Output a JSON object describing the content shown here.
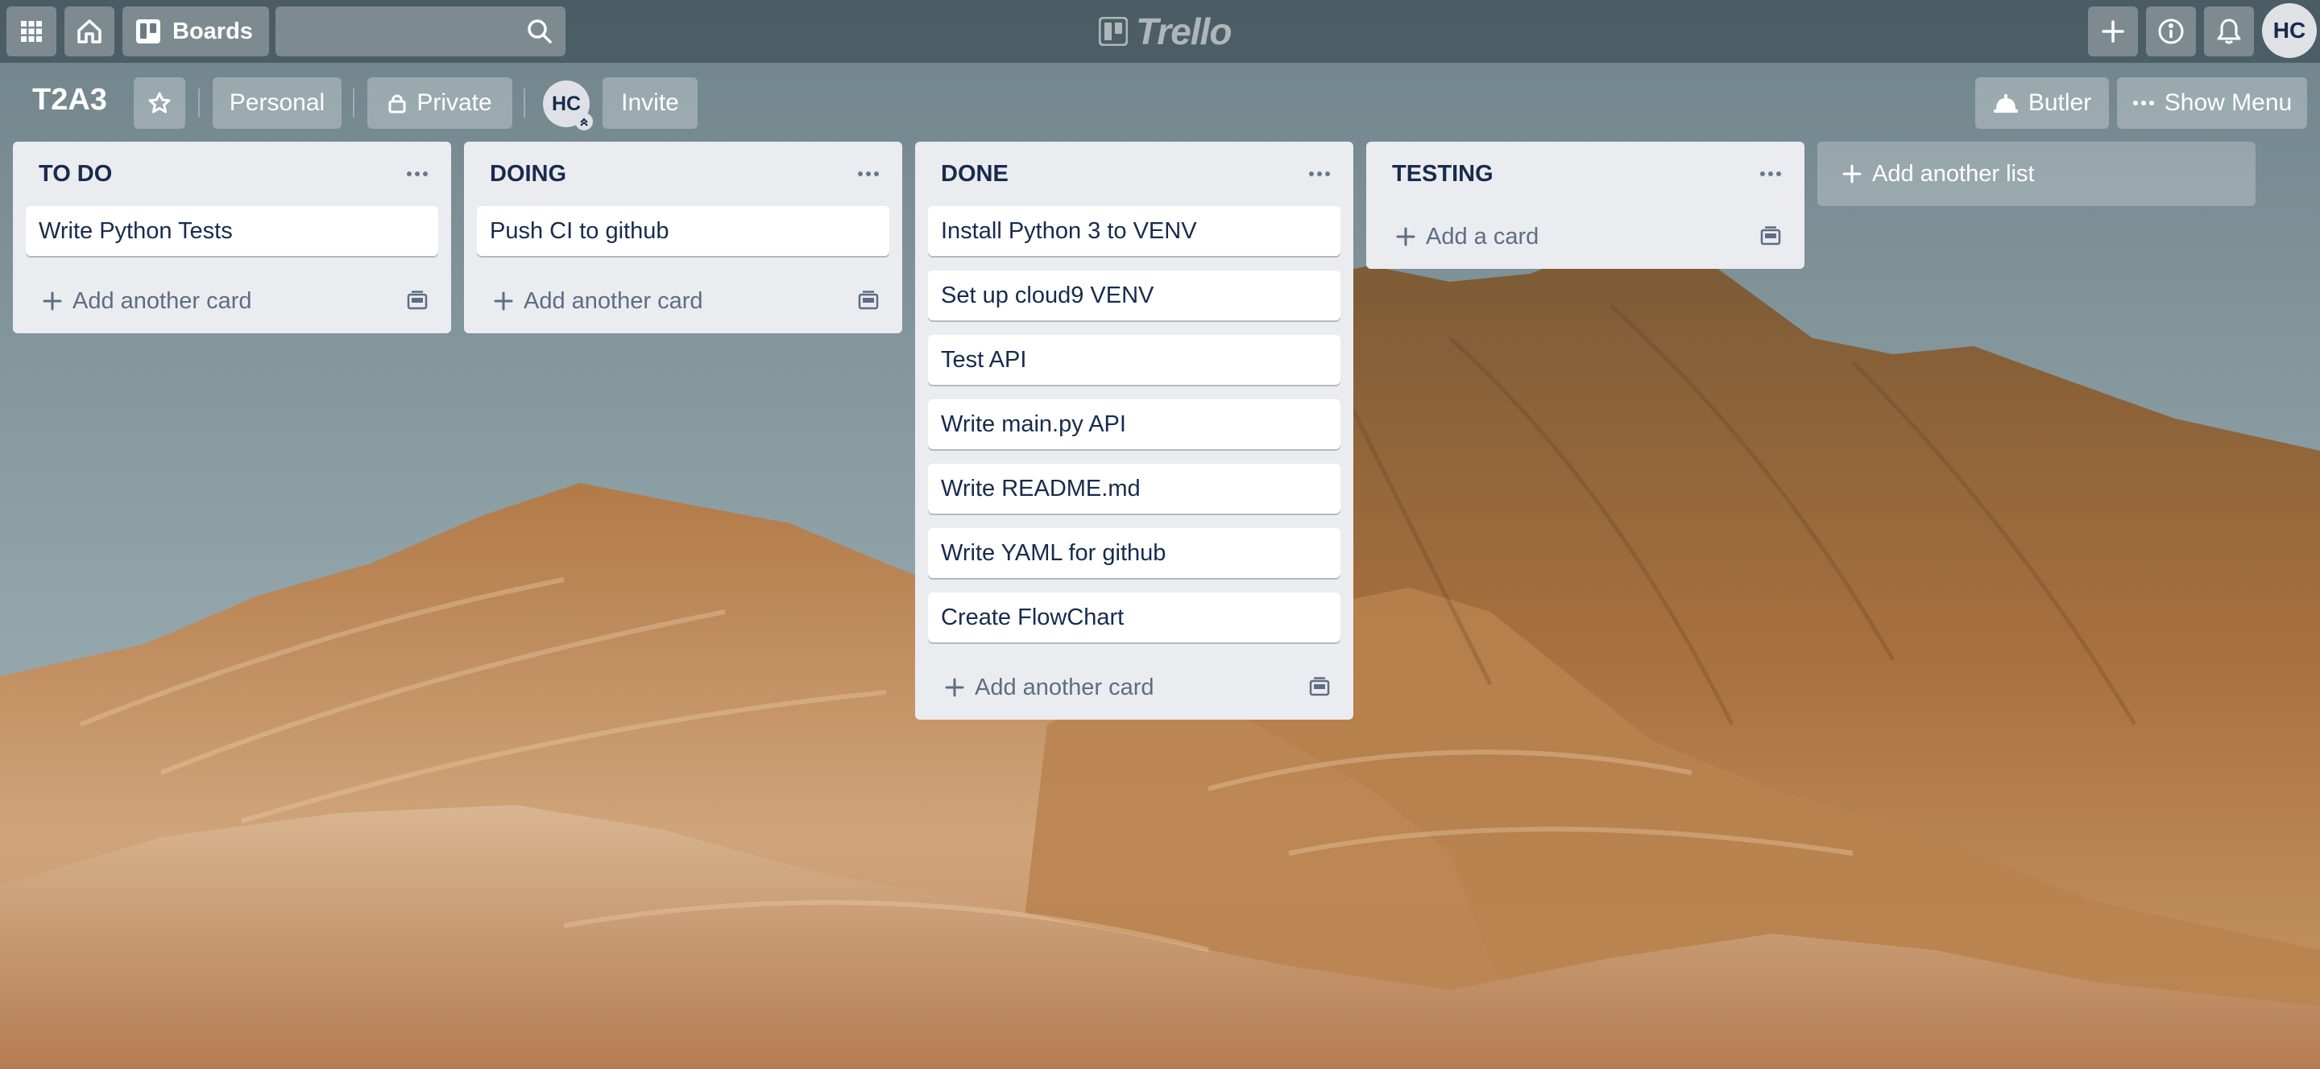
{
  "header": {
    "apps_icon": "grid-icon",
    "home_icon": "home-icon",
    "boards_label": "Boards",
    "search_placeholder": "",
    "logo_text": "Trello",
    "avatar_initials": "HC"
  },
  "board": {
    "title": "T2A3",
    "visibility_team": "Personal",
    "visibility_privacy": "Private",
    "member_initials": "HC",
    "invite_label": "Invite",
    "butler_label": "Butler",
    "show_menu_label": "Show Menu"
  },
  "lists": [
    {
      "title": "TO DO",
      "cards": [
        "Write Python Tests"
      ],
      "add_label": "Add another card"
    },
    {
      "title": "DOING",
      "cards": [
        "Push CI to github"
      ],
      "add_label": "Add another card"
    },
    {
      "title": "DONE",
      "cards": [
        "Install Python 3 to VENV",
        "Set up cloud9 VENV",
        "Test API",
        "Write main.py API",
        "Write README.md",
        "Write YAML for github",
        "Create FlowChart"
      ],
      "add_label": "Add another card"
    },
    {
      "title": "TESTING",
      "cards": [],
      "add_label": "Add a card"
    }
  ],
  "add_list_label": "Add another list",
  "colors": {
    "sky": "#8ea3aa",
    "header_bg": "#2e3e46",
    "list_bg": "#ebecf0",
    "text_dark": "#172b4d",
    "text_muted": "#5e6c84"
  }
}
